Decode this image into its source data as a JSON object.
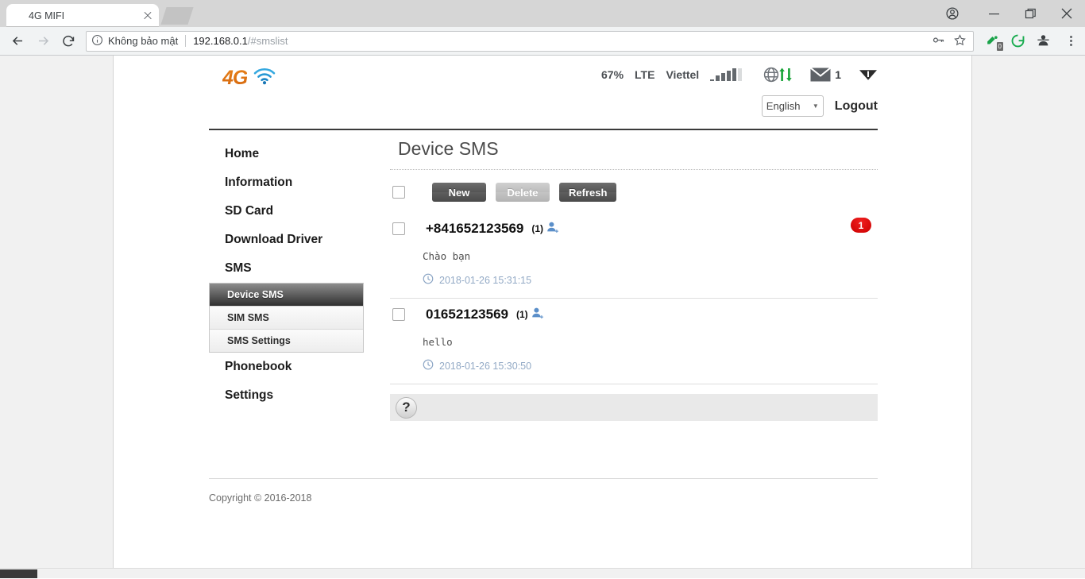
{
  "browser": {
    "tab_title": "4G MIFI",
    "security_label": "Không bảo mật",
    "url_host": "192.168.0.1",
    "url_path": "/#smslist",
    "extension_badge": "0",
    "icons": {
      "back": "back-arrow-icon",
      "forward": "forward-arrow-icon",
      "reload": "reload-icon",
      "info": "info-circle-icon",
      "key": "password-key-icon",
      "star": "bookmark-star-icon",
      "profile": "profile-avatar-icon",
      "minimize": "minimize-icon",
      "maximize": "maximize-icon",
      "close": "window-close-icon",
      "menu": "three-dots-menu-icon"
    }
  },
  "header": {
    "logo_text": "4G",
    "status": {
      "battery": "67%",
      "network_type": "LTE",
      "carrier": "Viettel",
      "signal_bars_filled": 4,
      "signal_bars_total": 5,
      "mail_count": "1"
    },
    "language": "English",
    "logout_label": "Logout"
  },
  "sidebar": {
    "items": [
      {
        "label": "Home",
        "type": "top"
      },
      {
        "label": "Information",
        "type": "top"
      },
      {
        "label": "SD Card",
        "type": "top"
      },
      {
        "label": "Download Driver",
        "type": "top"
      },
      {
        "label": "SMS",
        "type": "top"
      }
    ],
    "sub_items": [
      {
        "label": "Device SMS",
        "active": true
      },
      {
        "label": "SIM SMS",
        "active": false
      },
      {
        "label": "SMS Settings",
        "active": false
      }
    ],
    "items_after": [
      {
        "label": "Phonebook",
        "type": "top"
      },
      {
        "label": "Settings",
        "type": "top"
      }
    ]
  },
  "main": {
    "title": "Device SMS",
    "toolbar": {
      "new_label": "New",
      "delete_label": "Delete",
      "refresh_label": "Refresh"
    },
    "messages": [
      {
        "number": "+841652123569",
        "count": "(1)",
        "body": "Chào bạn",
        "time": "2018-01-26 15:31:15",
        "badge": "1"
      },
      {
        "number": "01652123569",
        "count": "(1)",
        "body": "hello",
        "time": "2018-01-26 15:30:50",
        "badge": ""
      }
    ],
    "help_glyph": "?"
  },
  "footer": {
    "copyright": "Copyright © 2016-2018"
  },
  "colors": {
    "accent_orange": "#d4660e",
    "wifi_blue": "#1f9bd8",
    "badge_red": "#cc0000",
    "active_nav_dark": "#2f2f2f",
    "time_blue": "#93aac6",
    "green_arrows": "#16a336"
  }
}
